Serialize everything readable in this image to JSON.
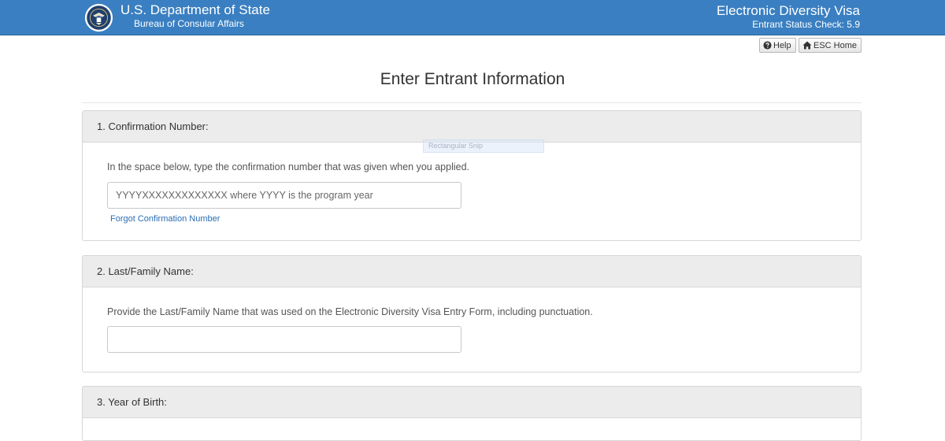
{
  "header": {
    "department": "U.S. Department of State",
    "bureau": "Bureau of Consular Affairs",
    "app_title": "Electronic Diversity Visa",
    "app_version": "Entrant Status Check: 5.9",
    "seal_icon": "seal-icon",
    "background_color": "#3a7fc1"
  },
  "toolbar": {
    "help_label": "Help",
    "help_icon": "question-circle-icon",
    "home_label": "ESC Home",
    "home_icon": "home-icon"
  },
  "page": {
    "title": "Enter Entrant Information"
  },
  "sections": {
    "confirmation": {
      "heading": "1. Confirmation Number:",
      "instruction": "In the space below, type the confirmation number that was given when you applied.",
      "placeholder": "YYYYXXXXXXXXXXXXX where YYYY is the program year",
      "value": "",
      "forgot_link": "Forgot Confirmation Number"
    },
    "last_name": {
      "heading": "2. Last/Family Name:",
      "instruction": "Provide the Last/Family Name that was used on the Electronic Diversity Visa Entry Form, including punctuation.",
      "value": ""
    },
    "year_of_birth": {
      "heading": "3. Year of Birth:"
    }
  },
  "overlay": {
    "snip_label": "Rectangular Snip"
  }
}
